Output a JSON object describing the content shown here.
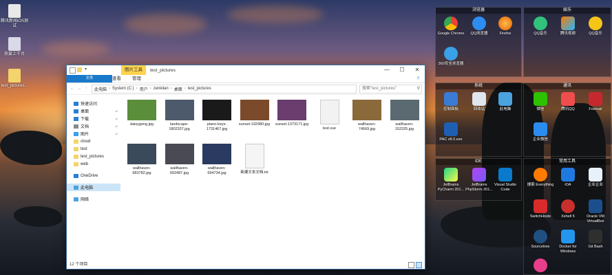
{
  "desktop_left": [
    {
      "label": "腾讯新闻iOS测试"
    },
    {
      "label": "热爱上千台"
    },
    {
      "label": "test_pictures..."
    }
  ],
  "window": {
    "quick_access_icons": [
      "properties-icon",
      "new-folder-icon",
      "pin-icon"
    ],
    "context_tab": "图片工具",
    "title": "test_pictures",
    "controls": {
      "minimize": "—",
      "maximize": "☐",
      "close": "✕"
    },
    "ribbon_tabs": [
      "文件",
      "主页",
      "共享",
      "查看",
      "管理"
    ],
    "help": "?",
    "nav": {
      "back": "←",
      "forward": "→",
      "up": "↑"
    },
    "breadcrumbs": [
      "此电脑",
      "System (C:)",
      "用户",
      "zenkilan",
      "桌面",
      "test_pictures"
    ],
    "search_placeholder": "搜索\"test_pictures\"",
    "sidebar": [
      {
        "label": "快速访问",
        "icon": "star-icon",
        "pinned": false
      },
      {
        "label": "桌面",
        "icon": "desktop-icon",
        "pinned": true
      },
      {
        "label": "下载",
        "icon": "download-icon",
        "pinned": true
      },
      {
        "label": "文档",
        "icon": "document-icon",
        "pinned": true
      },
      {
        "label": "图片",
        "icon": "picture-icon",
        "pinned": true
      },
      {
        "label": "cloud",
        "icon": "folder-icon",
        "pinned": false
      },
      {
        "label": "test",
        "icon": "folder-icon",
        "pinned": false
      },
      {
        "label": "test_pictures",
        "icon": "folder-icon",
        "pinned": false
      },
      {
        "label": "web",
        "icon": "folder-icon",
        "pinned": false
      },
      {
        "label": "OneDrive",
        "icon": "cloud-icon",
        "pinned": false
      },
      {
        "label": "此电脑",
        "icon": "computer-icon",
        "pinned": false
      },
      {
        "label": "网络",
        "icon": "network-icon",
        "pinned": false
      }
    ],
    "pin_glyph": "📌",
    "files": [
      {
        "name": "daisygong.jpg",
        "color": "#5b8e3a"
      },
      {
        "name": "landscape-1802337.jpg",
        "color": "#4d5a6b"
      },
      {
        "name": "piano-keys-1731467.jpg",
        "color": "#1a1a1a"
      },
      {
        "name": "sunset-192980.jpg",
        "color": "#7a4a2a"
      },
      {
        "name": "sunset-1373171.jpg",
        "color": "#6a3d6e"
      },
      {
        "name": "test.vue",
        "color": "#f2f2f2"
      },
      {
        "name": "wallhaven-74569.jpg",
        "color": "#8a6a3a"
      },
      {
        "name": "wallhaven-152325.jpg",
        "color": "#5a6a70"
      },
      {
        "name": "wallhaven-683782.jpg",
        "color": "#3a4a5a"
      },
      {
        "name": "wallhaven-692487.jpg",
        "color": "#4a4a55"
      },
      {
        "name": "wallhaven-694734.jpg",
        "color": "#2a3a60"
      },
      {
        "name": "新建文本文档.txt",
        "color": "#f5f5f5"
      }
    ],
    "status": "12 个项目"
  },
  "fences": {
    "browser": {
      "title": "浏览器",
      "items": [
        "Google Chrome",
        "QQ浏览器",
        "Firefox",
        "360安全浏览器"
      ]
    },
    "entertainment": {
      "title": "娱乐",
      "items": [
        "QQ音乐",
        "腾讯视频",
        "QQ音乐"
      ]
    },
    "system": {
      "title": "系统",
      "items": [
        "控制面板",
        "回收站",
        "此电脑",
        "PAC v8.0.exe"
      ]
    },
    "comm": {
      "title": "通讯",
      "items": [
        "微信",
        "腾讯QQ",
        "Foxmail",
        "企业微信"
      ]
    },
    "ide": {
      "title": "IDE",
      "items": [
        "JetBrains PyCharm 201...",
        "JetBrains PhpStorm 201...",
        "Visual Studio Code"
      ]
    },
    "tools": {
      "title": "常用工具",
      "items": [
        "搜索 Everything",
        "iOA",
        "企业企业",
        "SwitchHosts",
        "Xshell 5",
        "Oracle VM VirtualBox",
        "Sourcetree",
        "Docker for Windows",
        "Git Bash"
      ]
    }
  }
}
